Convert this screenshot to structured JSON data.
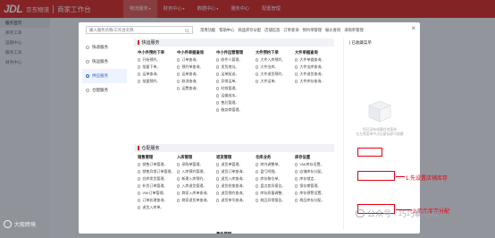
{
  "topbar": {
    "logo_mark": "JDL",
    "brand": "京东物流",
    "workspace": "商家工作台",
    "nav": [
      {
        "label": "物流服务",
        "active": true
      },
      {
        "label": "财务中心",
        "active": false
      },
      {
        "label": "数据中心",
        "active": false
      },
      {
        "label": "服务中心",
        "active": false
      },
      {
        "label": "配置管理",
        "active": false
      }
    ]
  },
  "bg_sidebar": {
    "items": [
      "服务首页",
      "库存工单",
      "运输中心",
      "服务工具",
      "财务中心"
    ]
  },
  "modal": {
    "search_placeholder": "输入服务名称/工作台名称",
    "quick_nav": [
      "常用功能",
      "帮助中心",
      "商品库存分配",
      "店铺信息",
      "订单查询",
      "预约单管理",
      "报价查询",
      "采购单管理"
    ],
    "close": "×",
    "sidebar": [
      {
        "label": "快递服务",
        "active": false
      },
      {
        "label": "快运服务",
        "active": false
      },
      {
        "label": "供应服务",
        "active": true
      },
      {
        "label": "仓配服务",
        "active": false
      }
    ],
    "sections": [
      {
        "title": "快运服务",
        "columns": [
          {
            "title": "中小件预约下单",
            "items": [
              "开始预约",
              "批量下单",
              "运单查询",
              "批量预约"
            ]
          },
          {
            "title": "中小件单据查询",
            "items": [
              "订单查询",
              "预约单查询",
              "运单查询",
              "取消查询",
              "运费查询"
            ]
          },
          {
            "title": "中小件运营管理",
            "items": [
              "收件人管理",
              "发货地址",
              "运单配送",
              "异常运单",
              "时效管理",
              "运输成本",
              "售后管理",
              "服务商管理"
            ]
          },
          {
            "title": "大件预约下单",
            "items": [
              "大件入库预约",
              "大件出库",
              "大件退货预约",
              "大件运单"
            ]
          },
          {
            "title": "大件单据查询",
            "items": [
              "大件单据查询",
              "大件出库查询",
              "大件退货查询",
              "大件库存查询"
            ]
          }
        ]
      },
      {
        "title": "仓配服务",
        "columns": [
          {
            "title": "销售管理",
            "items": [
              "销售订单管理",
              "销售异常订单管理",
              "仓库发货管理",
              "补货订单管理",
              "VMI订单管理",
              "订单处理查询",
              "退货入库单"
            ]
          },
          {
            "title": "入库管理",
            "items": [
              "采购单管理",
              "入库预约管理",
              "新建入库预约",
              "入库退货管理",
              "商家入库单查询",
              "商家退货单查询"
            ]
          },
          {
            "title": "退货管理",
            "items": [
              "退货单管理",
              "退货订单查询",
              "退货入库查询",
              "退货检查查询",
              "退货预约查询",
              "退货单号查询"
            ]
          },
          {
            "title": "仓库业务",
            "items": [
              "库内调整单",
              "盘亏明细",
              "库存移位单",
              "盘点差异报告",
              "库存质量调整",
              "商品异常报告"
            ]
          },
          {
            "title": "库存设置",
            "items": [
              "VMI库存设置",
              "店铺库存分配",
              "库存锁定",
              "保存期管理",
              "库存预警设置",
              "商品库存分配"
            ]
          }
        ],
        "extra_col_titles": [
          "仓储费用",
          "事件管理"
        ]
      }
    ],
    "favorites": {
      "title": "| 已收藏菜单",
      "empty_line1": "您还没有收藏任何菜单",
      "empty_line2": "在左侧菜单中点击星标即可收藏"
    }
  },
  "annotations": {
    "step1": "1.先设置店铺库存",
    "step2": "2.商品库存分配"
  },
  "watermarks": {
    "left": "大般跨境",
    "right": "公众号 · 巧巧聊电商"
  },
  "colors": {
    "brand_red": "#d7261f",
    "annotation_red": "#e60012",
    "active_blue": "#2f5fd0"
  }
}
